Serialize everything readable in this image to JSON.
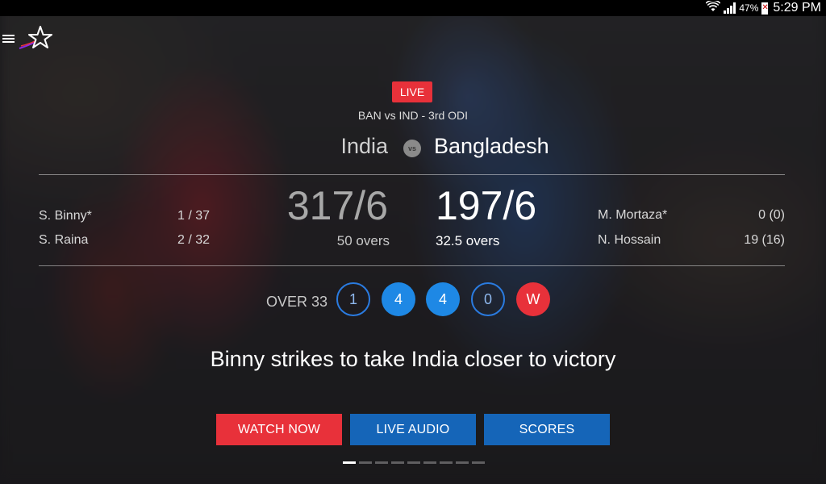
{
  "status_bar": {
    "battery": "47%",
    "time": "5:29 PM"
  },
  "match": {
    "badge": "LIVE",
    "title": "BAN vs IND - 3rd ODI",
    "team_left": "India",
    "vs_label": "vs",
    "team_right": "Bangladesh"
  },
  "innings_left": {
    "score": "317/6",
    "overs": "50 overs",
    "batsmen": [
      {
        "name": "S. Binny*",
        "figures": "1 / 37"
      },
      {
        "name": "S. Raina",
        "figures": "2 / 32"
      }
    ]
  },
  "innings_right": {
    "score": "197/6",
    "overs": "32.5 overs",
    "players": [
      {
        "name": "M. Mortaza*",
        "figures": "0 (0)"
      },
      {
        "name": "N. Hossain",
        "figures": "19 (16)"
      }
    ]
  },
  "over": {
    "label": "OVER 33",
    "balls": [
      {
        "value": "1",
        "kind": "run"
      },
      {
        "value": "4",
        "kind": "boundary"
      },
      {
        "value": "4",
        "kind": "boundary"
      },
      {
        "value": "0",
        "kind": "run"
      },
      {
        "value": "W",
        "kind": "wicket"
      }
    ]
  },
  "headline": "Binny strikes to take India closer to victory",
  "buttons": {
    "watch": "WATCH NOW",
    "audio": "LIVE AUDIO",
    "scores": "SCORES"
  },
  "pager": {
    "count": 9,
    "active": 1
  },
  "colors": {
    "live_red": "#e8313a",
    "button_blue": "#1565b8",
    "ball_blue": "#1e88e5"
  }
}
